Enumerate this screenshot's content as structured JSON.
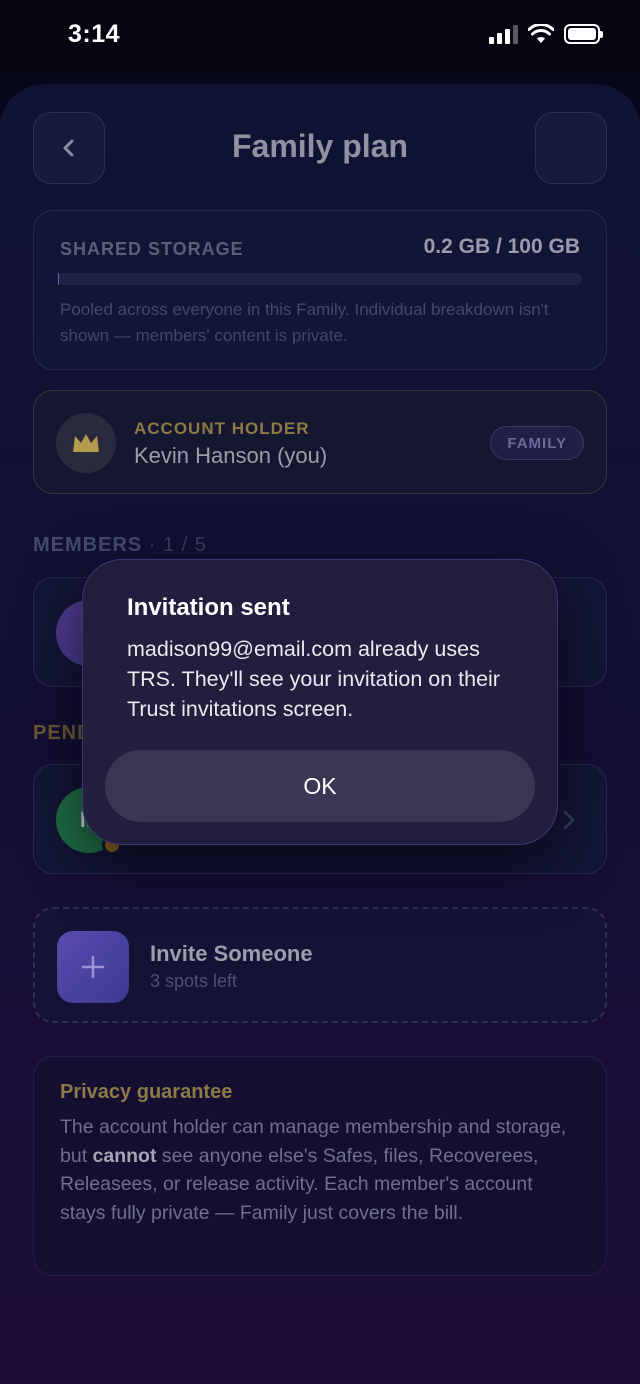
{
  "status_bar": {
    "time": "3:14"
  },
  "header": {
    "title": "Family plan"
  },
  "storage": {
    "label": "SHARED STORAGE",
    "value": "0.2 GB / 100 GB",
    "used_fraction": 0.002,
    "note": "Pooled across everyone in this Family. Individual breakdown isn't shown — members' content is private."
  },
  "account_holder": {
    "label": "ACCOUNT HOLDER",
    "name": "Kevin Hanson (you)",
    "badge": "FAMILY"
  },
  "members": {
    "title": "MEMBERS",
    "count": " · 1 / 5"
  },
  "pending": {
    "title": "PENDING",
    "avatar_initial": "M"
  },
  "invite": {
    "title": "Invite Someone",
    "subtitle": "3 spots left"
  },
  "privacy": {
    "title": "Privacy guarantee",
    "body_before": "The account holder can manage membership and storage, but ",
    "body_bold": "cannot",
    "body_after": " see anyone else's Safes, files, Recoverees, Releasees, or release activity. Each member's account stays fully private — Family just covers the bill."
  },
  "dialog": {
    "title": "Invitation sent",
    "message": "madison99@email.com already uses TRS. They'll see your invitation on their Trust invitations screen.",
    "ok_label": "OK"
  },
  "colors": {
    "accent": "#6a5ad0",
    "gold": "#8c7a48",
    "background": "#101333"
  }
}
